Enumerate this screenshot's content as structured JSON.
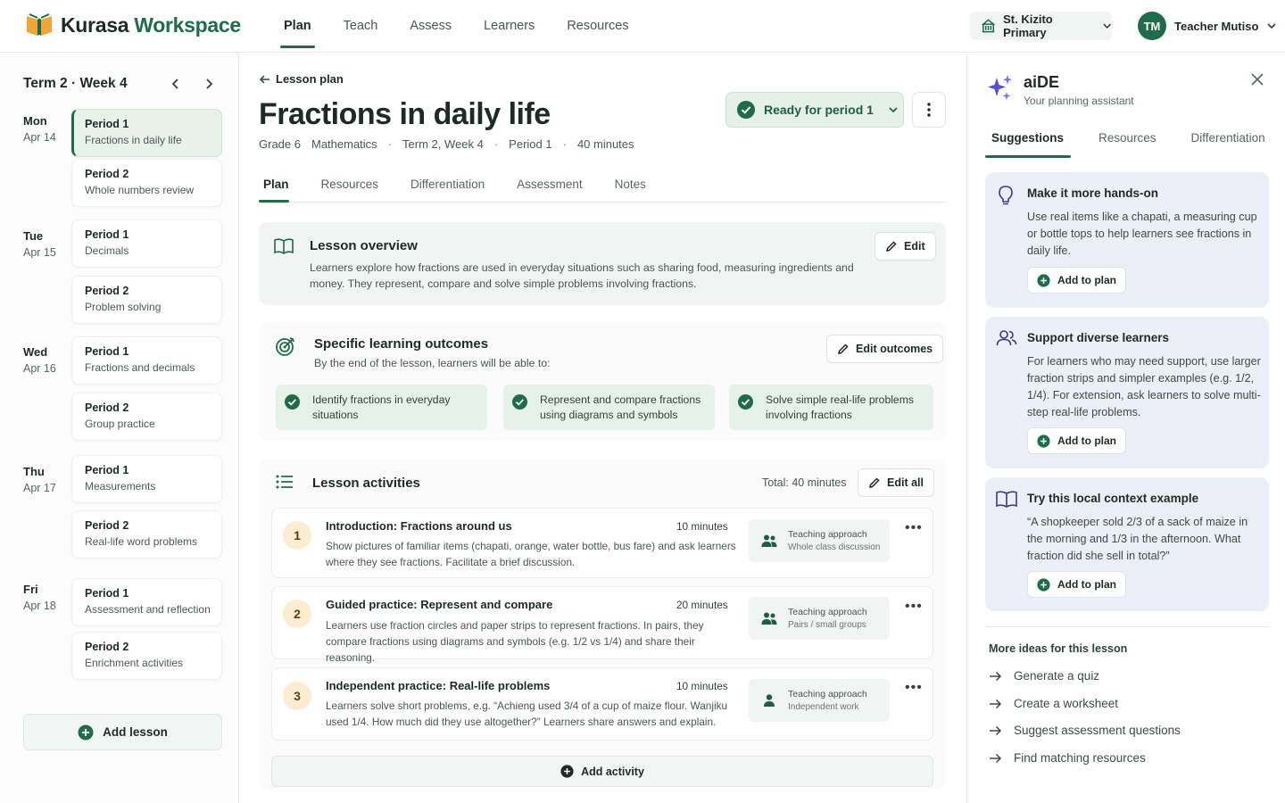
{
  "app": {
    "name_part1": "Kurasa",
    "name_part2": "Workspace"
  },
  "nav": [
    "Plan",
    "Teach",
    "Assess",
    "Learners",
    "Resources"
  ],
  "school": "St. Kizito Primary",
  "user": {
    "initials": "TM",
    "name": "Teacher Mutiso"
  },
  "week": {
    "label": "Term 2 · Week 4"
  },
  "days": [
    {
      "name": "Mon",
      "date": "Apr 14",
      "periods": [
        {
          "p": "Period 1",
          "topic": "Fractions in daily life"
        },
        {
          "p": "Period 2",
          "topic": "Whole numbers review"
        }
      ]
    },
    {
      "name": "Tue",
      "date": "Apr 15",
      "periods": [
        {
          "p": "Period 1",
          "topic": "Decimals"
        },
        {
          "p": "Period 2",
          "topic": "Problem solving"
        }
      ]
    },
    {
      "name": "Wed",
      "date": "Apr 16",
      "periods": [
        {
          "p": "Period 1",
          "topic": "Fractions and decimals"
        },
        {
          "p": "Period 2",
          "topic": "Group practice"
        }
      ]
    },
    {
      "name": "Thu",
      "date": "Apr 17",
      "periods": [
        {
          "p": "Period 1",
          "topic": "Measurements"
        },
        {
          "p": "Period 2",
          "topic": "Real-life word problems"
        }
      ]
    },
    {
      "name": "Fri",
      "date": "Apr 18",
      "periods": [
        {
          "p": "Period 1",
          "topic": "Assessment and reflection"
        },
        {
          "p": "Period 2",
          "topic": "Enrichment activities"
        }
      ]
    }
  ],
  "add_lesson": "Add lesson",
  "lesson": {
    "back": "Lesson plan",
    "title": "Fractions in daily life",
    "meta": [
      "Grade 6",
      "Mathematics",
      "Term 2, Week 4",
      "Period 1",
      "40 minutes"
    ],
    "status": "Ready for period 1",
    "tabs": [
      "Plan",
      "Resources",
      "Differentiation",
      "Assessment",
      "Notes"
    ]
  },
  "overview": {
    "title": "Lesson overview",
    "edit": "Edit",
    "text": "Learners explore how fractions are used in everyday situations such as sharing food, measuring ingredients and money. They represent, compare and solve simple problems involving fractions."
  },
  "outcomes": {
    "title": "Specific learning outcomes",
    "subtitle": "By the end of the lesson, learners will be able to:",
    "edit": "Edit outcomes",
    "items": [
      "Identify fractions in everyday situations",
      "Represent and compare fractions using diagrams and symbols",
      "Solve simple real-life problems involving fractions"
    ]
  },
  "activities": {
    "title": "Lesson activities",
    "total": "Total: 40 minutes",
    "edit": "Edit all",
    "approach_label": "Teaching approach",
    "items": [
      {
        "num": "1",
        "title": "Introduction: Fractions around us",
        "minutes": "10 minutes",
        "desc": "Show pictures of familiar items (chapati, orange, water bottle, bus fare) and ask learners where they see fractions. Facilitate a brief discussion.",
        "approach": "Whole class discussion"
      },
      {
        "num": "2",
        "title": "Guided practice: Represent and compare",
        "minutes": "20 minutes",
        "desc": "Learners use fraction circles and paper strips to represent fractions. In pairs, they compare fractions using diagrams and symbols (e.g. 1/2 vs 1/4) and share their reasoning.",
        "approach": "Pairs / small groups"
      },
      {
        "num": "3",
        "title": "Independent practice: Real-life problems",
        "minutes": "10 minutes",
        "desc": "Learners solve short problems, e.g. “Achieng used 3/4 of a cup of maize flour. Wanjiku used 1/4. How much did they use altogether?” Learners share answers and explain.",
        "approach": "Independent work"
      }
    ],
    "add": "Add activity"
  },
  "assistant": {
    "title": "aiDE",
    "subtitle": "Your planning assistant",
    "tabs": [
      "Suggestions",
      "Resources",
      "Differentiation"
    ],
    "add_to_plan": "Add to plan",
    "suggestions": [
      {
        "title": "Make it more hands-on",
        "text": "Use real items like a chapati, a measuring cup or bottle tops to help learners see fractions in daily life.",
        "icon": "lightbulb-icon"
      },
      {
        "title": "Support diverse learners",
        "text": "For learners who may need support, use larger fraction strips and simpler examples (e.g. 1/2, 1/4). For extension, ask learners to solve multi-step real-life problems.",
        "icon": "people-icon"
      },
      {
        "title": "Try this local context example",
        "text": "“A shopkeeper sold 2/3 of a sack of maize in the morning and 1/3 in the afternoon. What fraction did she sell in total?”",
        "icon": "book-icon"
      }
    ],
    "more_title": "More ideas for this lesson",
    "more": [
      "Generate a quiz",
      "Create a worksheet",
      "Suggest assessment questions",
      "Find matching resources"
    ]
  },
  "colors": {
    "brand": "#1f6b4a",
    "accent_orange": "#f0a53a",
    "suggestion_bg": "#eceef8",
    "outcome_bg": "#e7f1eb"
  }
}
